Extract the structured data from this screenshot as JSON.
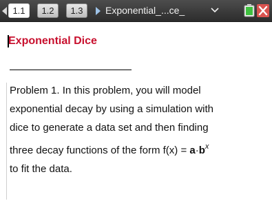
{
  "header": {
    "tabs": [
      {
        "label": "1.1",
        "active": true
      },
      {
        "label": "1.2",
        "active": false
      },
      {
        "label": "1.3",
        "active": false
      }
    ],
    "document_title": "Exponential_...ce_",
    "icons": [
      "nav-left-arrow",
      "nav-right-arrow",
      "dropdown-chevron",
      "battery",
      "close-x"
    ]
  },
  "page": {
    "heading": "Exponential Dice",
    "lines": [
      "Problem 1. In this problem, you will model",
      "exponential decay by using a simulation with",
      "dice to generate a data set and then finding",
      "three decay functions of the form f(x) = ",
      "to fit the data."
    ],
    "formula": {
      "a": "a",
      "dot": "·",
      "b": "b",
      "exponent": "x"
    }
  },
  "colors": {
    "heading_red": "#c8102e",
    "toolbar_dark": "#333333",
    "battery_green": "#3fbf3f",
    "close_red": "#d9534f"
  }
}
